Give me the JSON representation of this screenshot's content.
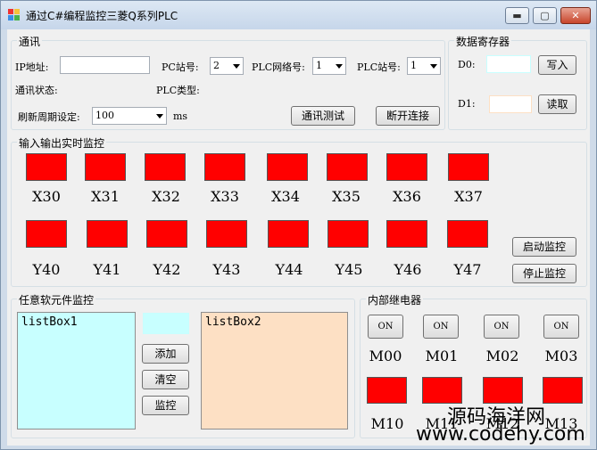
{
  "window": {
    "title": "通过C#编程监控三菱Q系列PLC",
    "min_label": "▬",
    "max_label": "▢",
    "close_label": "✕"
  },
  "comm": {
    "group_label": "通讯",
    "ip_label": "IP地址:",
    "ip_value": "",
    "pc_station_label": "PC站号:",
    "pc_station_value": "2",
    "plc_network_label": "PLC网络号:",
    "plc_network_value": "1",
    "plc_station_label": "PLC站号:",
    "plc_station_value": "1",
    "status_label": "通讯状态:",
    "plc_type_label": "PLC类型:",
    "refresh_label": "刷新周期设定:",
    "refresh_value": "100",
    "refresh_unit": "ms",
    "test_button": "通讯测试",
    "disconnect_button": "断开连接"
  },
  "register": {
    "group_label": "数据寄存器",
    "d0_label": "D0:",
    "d0_value": "",
    "d0_color": "#c8ffff",
    "write_button": "写入",
    "d1_label": "D1:",
    "d1_value": "",
    "d1_color": "#fde0c4",
    "read_button": "读取"
  },
  "io": {
    "group_label": "输入输出实时监控",
    "led_color": "#ff0000",
    "inputs": [
      "X30",
      "X31",
      "X32",
      "X33",
      "X34",
      "X35",
      "X36",
      "X37"
    ],
    "outputs": [
      "Y40",
      "Y41",
      "Y42",
      "Y43",
      "Y44",
      "Y45",
      "Y46",
      "Y47"
    ],
    "start_button": "启动监控",
    "stop_button": "停止监控"
  },
  "soft": {
    "group_label": "任意软元件监控",
    "listbox1_label": "listBox1",
    "listbox1_color": "#c8ffff",
    "listbox2_label": "listBox2",
    "listbox2_color": "#fde0c4",
    "input_value": "",
    "add_button": "添加",
    "clear_button": "清空",
    "monitor_button": "监控"
  },
  "relay": {
    "group_label": "内部继电器",
    "on_buttons": [
      "ON",
      "ON",
      "ON",
      "ON"
    ],
    "top_labels": [
      "M00",
      "M01",
      "M02",
      "M03"
    ],
    "bottom_labels": [
      "M10",
      "M11",
      "M12",
      "M13"
    ]
  },
  "watermark": {
    "line1": "源码海洋网",
    "line2": "www.codehy.com"
  }
}
